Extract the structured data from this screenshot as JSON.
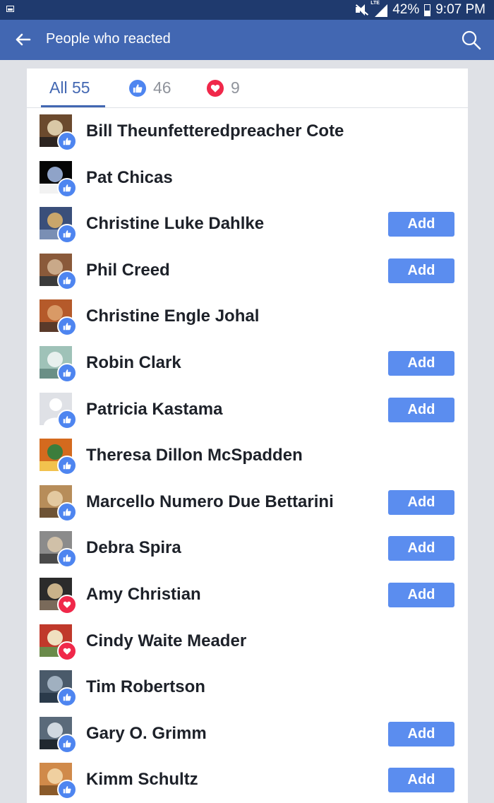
{
  "status": {
    "battery": "42%",
    "time": "9:07 PM",
    "network": "LTE"
  },
  "header": {
    "title": "People who reacted"
  },
  "tabs": [
    {
      "label": "All 55",
      "active": true
    },
    {
      "label": "46",
      "reaction": "like"
    },
    {
      "label": "9",
      "reaction": "love"
    }
  ],
  "colors": {
    "brand": "#4267b2",
    "status_bar": "#1f3a6e",
    "like": "#4e85f0",
    "love": "#f0284a",
    "add_button": "#5b8def"
  },
  "people": [
    {
      "name": "Bill Theunfetteredpreacher Cote",
      "reaction": "like",
      "add": false
    },
    {
      "name": "Pat Chicas",
      "reaction": "like",
      "add": false
    },
    {
      "name": "Christine Luke Dahlke",
      "reaction": "like",
      "add": true
    },
    {
      "name": "Phil Creed",
      "reaction": "like",
      "add": true
    },
    {
      "name": "Christine Engle Johal",
      "reaction": "like",
      "add": false
    },
    {
      "name": "Robin Clark",
      "reaction": "like",
      "add": true
    },
    {
      "name": "Patricia Kastama",
      "reaction": "like",
      "add": true
    },
    {
      "name": "Theresa Dillon McSpadden",
      "reaction": "like",
      "add": false
    },
    {
      "name": "Marcello Numero Due Bettarini",
      "reaction": "like",
      "add": true
    },
    {
      "name": "Debra Spira",
      "reaction": "like",
      "add": true
    },
    {
      "name": "Amy Christian",
      "reaction": "love",
      "add": true
    },
    {
      "name": "Cindy Waite Meader",
      "reaction": "love",
      "add": false
    },
    {
      "name": "Tim Robertson",
      "reaction": "like",
      "add": false
    },
    {
      "name": "Gary O. Grimm",
      "reaction": "like",
      "add": true
    },
    {
      "name": "Kimm Schultz",
      "reaction": "like",
      "add": true
    }
  ],
  "add_label": "Add"
}
